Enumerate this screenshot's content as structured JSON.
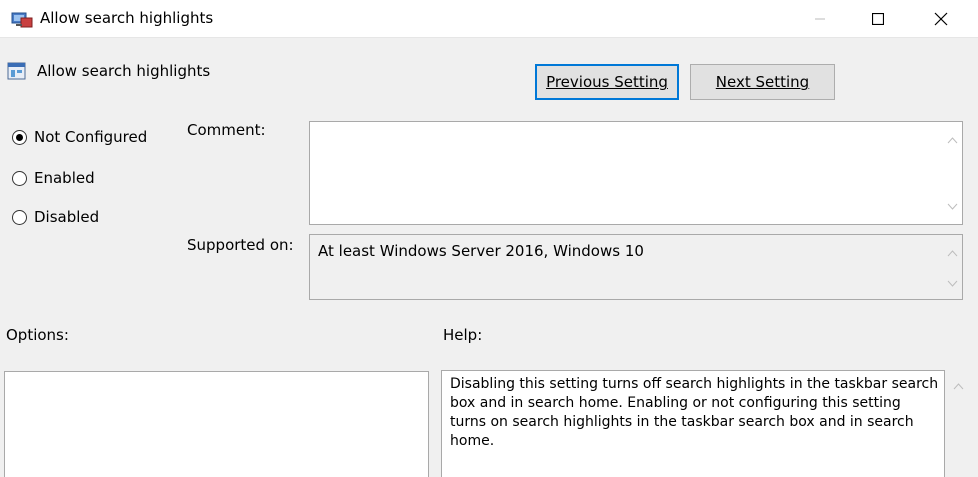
{
  "window": {
    "title": "Allow search highlights",
    "minimize_glyph": "—",
    "maximize_glyph": "☐",
    "close_glyph": "✕"
  },
  "header": {
    "setting_title": "Allow search highlights",
    "previous_label": "Previous Setting",
    "next_label": "Next Setting"
  },
  "state": {
    "options": [
      {
        "label": "Not Configured",
        "checked": true
      },
      {
        "label": "Enabled",
        "checked": false
      },
      {
        "label": "Disabled",
        "checked": false
      }
    ]
  },
  "comment": {
    "label": "Comment:",
    "value": ""
  },
  "supported": {
    "label": "Supported on:",
    "value": "At least Windows Server 2016, Windows 10"
  },
  "options_section": {
    "label": "Options:"
  },
  "help_section": {
    "label": "Help:",
    "text": "Disabling this setting turns off search highlights in the taskbar search box and in search home. Enabling or not configuring this setting turns on search highlights in the taskbar search box and in search home."
  },
  "colors": {
    "focus_border": "#0078d7",
    "background": "#f0f0f0"
  }
}
